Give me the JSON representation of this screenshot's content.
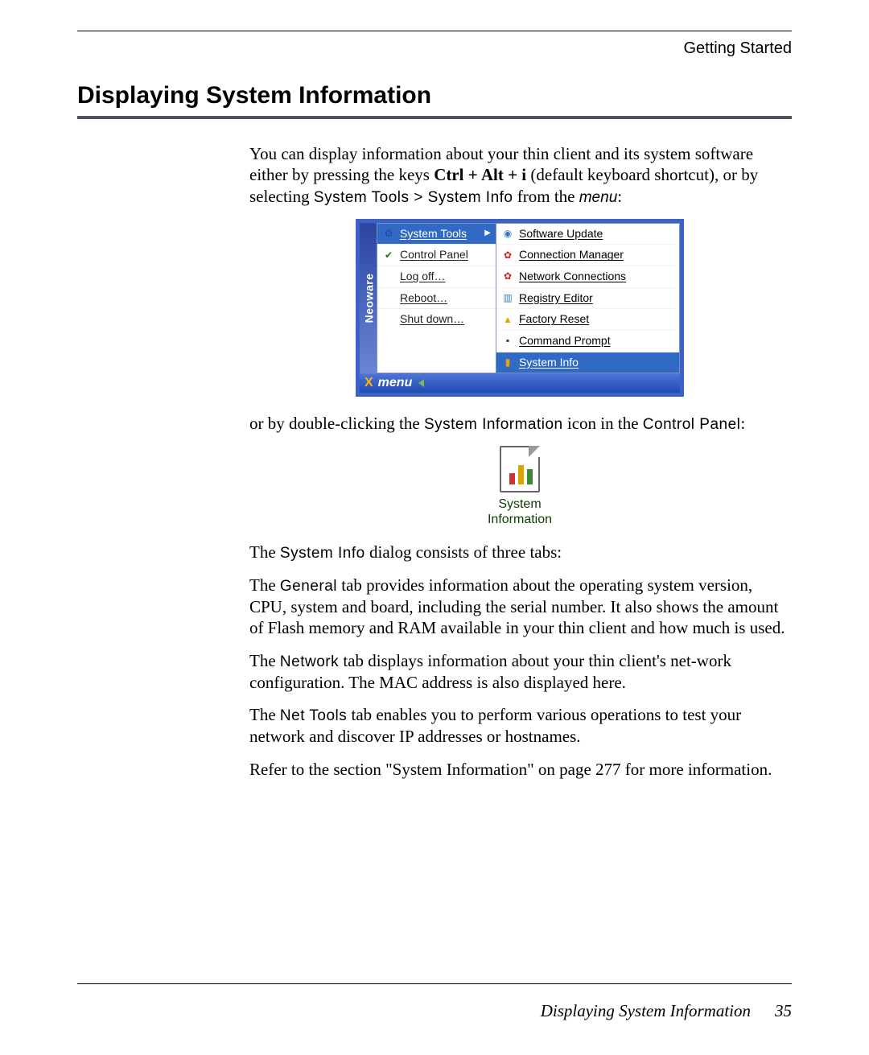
{
  "header": {
    "breadcrumb": "Getting Started"
  },
  "section": {
    "title": "Displaying System Information"
  },
  "intro": {
    "line1_a": "You can display information about your thin client and its system software either by pressing the keys ",
    "key_combo": "Ctrl + Alt + i",
    "line1_b": " (default keyboard shortcut), or by selecting ",
    "menu_path": "System Tools > System Info",
    "line1_c": " from the ",
    "menu_word": "menu",
    "line1_d": ":"
  },
  "menu_fig": {
    "brand": "Neoware",
    "left": {
      "system_tools": "System Tools",
      "control_panel": "Control Panel",
      "log_off": "Log off…",
      "reboot": "Reboot…",
      "shut_down": "Shut down…"
    },
    "right": {
      "software_update": "Software Update",
      "connection_manager": "Connection Manager",
      "network_connections": "Network Connections",
      "registry_editor": "Registry Editor",
      "factory_reset": "Factory Reset",
      "command_prompt": "Command Prompt",
      "system_info": "System Info"
    },
    "bar_label": "menu"
  },
  "para2": {
    "a": "or by double-clicking the ",
    "mono": "System Information",
    "b": " icon in the ",
    "mono2": "Control Panel",
    "c": ":"
  },
  "icon_fig": {
    "line1": "System",
    "line2": "Information"
  },
  "para3": {
    "a": "The ",
    "mono": "System Info",
    "b": " dialog consists of three tabs:"
  },
  "para_general": {
    "a": "The ",
    "mono": "General",
    "b": " tab provides information about the operating system version, CPU, system and board, including the serial number. It also shows the amount of Flash memory and RAM available in your thin client and how much is used."
  },
  "para_network": {
    "a": "The ",
    "mono": "Network",
    "b": " tab displays information about your thin client's net-work configuration. The MAC address is also displayed here."
  },
  "para_nettools": {
    "a": "The ",
    "mono": "Net Tools",
    "b": " tab enables you to perform various operations to test your network and discover IP addresses or hostnames."
  },
  "para_ref": "Refer to the section \"System Information\" on page 277 for more information.",
  "footer": {
    "section": "Displaying System Information",
    "page_num": "35"
  }
}
